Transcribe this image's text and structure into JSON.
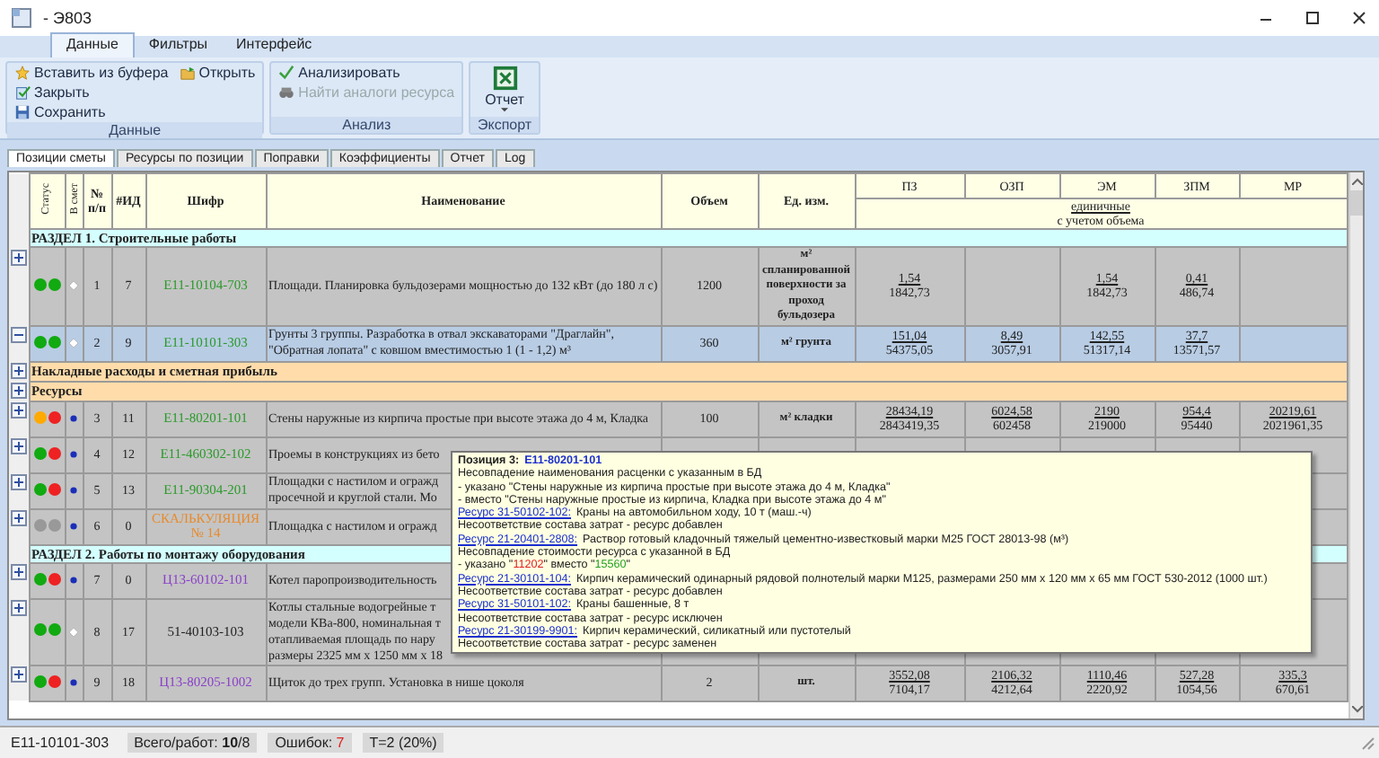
{
  "window": {
    "title": "- Э803"
  },
  "ribbon_tabs": [
    {
      "label": "Данные",
      "selected": true
    },
    {
      "label": "Фильтры",
      "selected": false
    },
    {
      "label": "Интерфейс",
      "selected": false
    }
  ],
  "ribbon": {
    "data_group": {
      "label": "Данные",
      "paste": "Вставить из буфера",
      "open": "Открыть",
      "close": "Закрыть",
      "save": "Сохранить"
    },
    "analysis_group": {
      "label": "Анализ",
      "analyze": "Анализировать",
      "find": {
        "label": "Найти аналоги ресурса",
        "disabled": true
      }
    },
    "export_group": {
      "label": "Экспорт",
      "report": "Отчет"
    }
  },
  "doc_tabs": [
    {
      "label": "Позиции сметы",
      "selected": true
    },
    {
      "label": "Ресурсы по позиции",
      "selected": false
    },
    {
      "label": "Поправки",
      "selected": false
    },
    {
      "label": "Коэффициенты",
      "selected": false
    },
    {
      "label": "Отчет",
      "selected": false
    },
    {
      "label": "Log",
      "selected": false
    }
  ],
  "table": {
    "header": {
      "status": "Статус",
      "in_estimate": "В смет",
      "num": "№ п/п",
      "id": "#ИД",
      "code": "Шифр",
      "name": "Наименование",
      "volume": "Объем",
      "unit": "Ед. изм.",
      "costs": {
        "pz": "ПЗ",
        "ozp": "ОЗП",
        "em": "ЭМ",
        "zpm": "ЗПМ",
        "mr": "МР"
      },
      "sub_underlined": "единичные",
      "sub": "с учетом объема"
    },
    "rows": [
      {
        "kind": "section",
        "text": "РАЗДЕЛ 1. Строительные работы"
      },
      {
        "kind": "item",
        "expanded": false,
        "selected": false,
        "dots": [
          {
            "color": "#11aa11"
          },
          {
            "color": "#11aa11"
          }
        ],
        "in_estimate": false,
        "num": "1",
        "id": "7",
        "code": "E11-10104-703",
        "color": "#2a9a2a",
        "name": "Площади. Планировка бульдозерами мощностью до 132 кВт (до 180 л с)",
        "volume": "1200",
        "unit": "м² спланированной поверхности за проход бульдозера",
        "costs": {
          "pz": {
            "unit": "1,54",
            "total": "1842,73"
          },
          "em": {
            "unit": "1,54",
            "total": "1842,73"
          },
          "zpm": {
            "unit": "0,41",
            "total": "486,74"
          }
        }
      },
      {
        "kind": "item",
        "expanded": true,
        "selected": true,
        "dots": [
          {
            "color": "#11aa11"
          },
          {
            "color": "#11aa11"
          }
        ],
        "in_estimate": false,
        "num": "2",
        "id": "9",
        "code": "E11-10101-303",
        "color": "#2a9a2a",
        "name": "Грунты 3 группы. Разработка в отвал экскаваторами \"Драглайн\", \"Обратная лопата\" с ковшом вместимостью 1 (1 - 1,2) м³",
        "volume": "360",
        "unit": "м² грунта",
        "costs": {
          "pz": {
            "unit": "151,04",
            "total": "54375,05"
          },
          "ozp": {
            "unit": "8,49",
            "total": "3057,91"
          },
          "em": {
            "unit": "142,55",
            "total": "51317,14"
          },
          "zpm": {
            "unit": "37,7",
            "total": "13571,57"
          }
        }
      },
      {
        "kind": "group",
        "expanded": false,
        "text": "Накладные расходы и сметная прибыль"
      },
      {
        "kind": "group",
        "expanded": false,
        "text": "Ресурсы"
      },
      {
        "kind": "item",
        "expanded": false,
        "selected": false,
        "dots": [
          {
            "color": "#ffaa00"
          },
          {
            "color": "#ee2222"
          }
        ],
        "in_estimate": true,
        "num": "3",
        "id": "11",
        "code": "E11-80201-101",
        "color": "#2a9a2a",
        "name": "Стены наружные из кирпича простые при высоте этажа до 4 м, Кладка",
        "volume": "100",
        "unit": "м² кладки",
        "costs": {
          "pz": {
            "unit": "28434,19",
            "total": "2843419,35"
          },
          "ozp": {
            "unit": "6024,58",
            "total": "602458"
          },
          "em": {
            "unit": "2190",
            "total": "219000"
          },
          "zpm": {
            "unit": "954,4",
            "total": "95440"
          },
          "mr": {
            "unit": "20219,61",
            "total": "2021961,35"
          }
        }
      },
      {
        "kind": "item",
        "expanded": false,
        "selected": false,
        "dots": [
          {
            "color": "#11aa11"
          },
          {
            "color": "#ee2222"
          }
        ],
        "in_estimate": true,
        "num": "4",
        "id": "12",
        "code": "E11-460302-102",
        "color": "#2a9a2a",
        "name": "Проемы в конструкциях из бето"
      },
      {
        "kind": "item",
        "expanded": false,
        "selected": false,
        "dots": [
          {
            "color": "#11aa11"
          },
          {
            "color": "#ee2222"
          }
        ],
        "in_estimate": true,
        "num": "5",
        "id": "13",
        "code": "E11-90304-201",
        "color": "#2a9a2a",
        "name": "Площадки с настилом и огражд\nпросечной и круглой стали. Мо"
      },
      {
        "kind": "item",
        "expanded": false,
        "selected": false,
        "dots": [
          {
            "color": "#999999"
          },
          {
            "color": "#999999"
          }
        ],
        "in_estimate": true,
        "num": "6",
        "id": "0",
        "code": "СКАЛЬКУЛЯЦИЯ № 14",
        "color": "#e88a2a",
        "name": "Площадка с настилом и огражд"
      },
      {
        "kind": "section",
        "text": "РАЗДЕЛ 2. Работы по монтажу оборудования"
      },
      {
        "kind": "item",
        "expanded": false,
        "selected": false,
        "dots": [
          {
            "color": "#11aa11"
          },
          {
            "color": "#ee2222"
          }
        ],
        "in_estimate": true,
        "num": "7",
        "id": "0",
        "code": "Ц13-60102-101",
        "color": "#8a3fc8",
        "name": "Котел паропроизводительность"
      },
      {
        "kind": "item",
        "expanded": false,
        "selected": false,
        "dots": [
          {
            "color": "#11aa11"
          },
          {
            "color": "#11aa11"
          }
        ],
        "in_estimate": false,
        "num": "8",
        "id": "17",
        "code": "51-40103-103",
        "color": "#222222",
        "name": "Котлы стальные водогрейные т\nмодели КВа-800, номинальная т\nотапливаемая площадь по нару\nразмеры 2325 мм х 1250 мм х 18"
      },
      {
        "kind": "item",
        "expanded": false,
        "selected": false,
        "dots": [
          {
            "color": "#11aa11"
          },
          {
            "color": "#ee2222"
          }
        ],
        "in_estimate": true,
        "num": "9",
        "id": "18",
        "code": "Ц13-80205-1002",
        "color": "#8a3fc8",
        "name": "Щиток до трех групп. Установка в нише цоколя",
        "volume": "2",
        "unit": "шт.",
        "costs": {
          "pz": {
            "unit": "3552,08",
            "total": "7104,17"
          },
          "ozp": {
            "unit": "2106,32",
            "total": "4212,64"
          },
          "em": {
            "unit": "1110,46",
            "total": "2220,92"
          },
          "zpm": {
            "unit": "527,28",
            "total": "1054,56"
          },
          "mr": {
            "unit": "335,3",
            "total": "670,61"
          }
        }
      }
    ]
  },
  "tooltip": {
    "title": "Позиция 3:",
    "code": "E11-80201-101",
    "lines": [
      {
        "kind": "text",
        "text": "Несовпадение наименования расценки с указанным в БД"
      },
      {
        "kind": "text",
        "text": " - указано \"Стены наружные из кирпича простые при высоте этажа до 4 м, Кладка\""
      },
      {
        "kind": "text",
        "text": " - вместо \"Стены наружные простые из кирпича, Кладка при высоте этажа до 4 м\""
      },
      {
        "kind": "resource",
        "link": "Ресурс 31-50102-102:",
        "text": "Краны на автомобильном ходу, 10 т (маш.-ч)"
      },
      {
        "kind": "text",
        "text": "Несоответствие состава затрат - ресурс добавлен"
      },
      {
        "kind": "resource",
        "link": "Ресурс 21-20401-2808:",
        "text": "Раствор готовый кладочный тяжелый цементно-известковый марки М25 ГОСТ 28013-98 (м³)"
      },
      {
        "kind": "text",
        "text": "Несовпадение стоимости ресурса с указанной в БД"
      },
      {
        "kind": "diff",
        "prefix": " - указано \"",
        "old": "11202",
        "mid": "\" вместо \"",
        "new": "15560",
        "suffix": "\""
      },
      {
        "kind": "resource",
        "link": "Ресурс 21-30101-104:",
        "text": "Кирпич керамический одинарный рядовой полнотелый марки М125, размерами 250 мм х 120 мм х 65 мм ГОСТ 530-2012 (1000 шт.)"
      },
      {
        "kind": "text",
        "text": "Несоответствие состава затрат - ресурс добавлен"
      },
      {
        "kind": "resource",
        "link": "Ресурс 31-50101-102:",
        "text": "Краны башенные, 8 т"
      },
      {
        "kind": "text",
        "text": "Несоответствие состава затрат - ресурс исключен"
      },
      {
        "kind": "resource",
        "link": "Ресурс 21-30199-9901:",
        "text": "Кирпич керамический, силикатный или пустотелый"
      },
      {
        "kind": "text",
        "text": "Несоответствие состава затрат - ресурс заменен"
      }
    ]
  },
  "status_bar": {
    "code": "E11-10101-303",
    "total": "Всего/работ: **10**/8",
    "errors_label": "Ошибок:",
    "errors": "7",
    "t": "Т=2 (20%)"
  }
}
